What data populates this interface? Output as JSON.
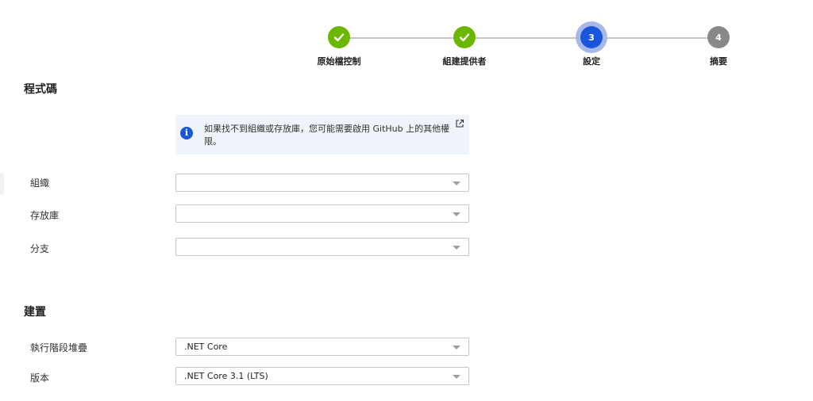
{
  "stepper": {
    "steps": [
      {
        "label": "原始檔控制",
        "number": "1",
        "state": "done"
      },
      {
        "label": "組建提供者",
        "number": "2",
        "state": "done"
      },
      {
        "label": "設定",
        "number": "3",
        "state": "current"
      },
      {
        "label": "摘要",
        "number": "4",
        "state": "todo"
      }
    ]
  },
  "code_section": {
    "title": "程式碼",
    "info_message": "如果找不到組織或存放庫，您可能需要啟用 GitHub 上的其他權限。",
    "organization_label": "組織",
    "organization_value": "",
    "repository_label": "存放庫",
    "repository_value": "",
    "branch_label": "分支",
    "branch_value": ""
  },
  "build_section": {
    "title": "建置",
    "runtime_stack_label": "執行階段堆疊",
    "runtime_stack_value": ".NET Core",
    "version_label": "版本",
    "version_value": ".NET Core 3.1 (LTS)"
  },
  "colors": {
    "done": "#6bb700",
    "current": "#1a56db",
    "todo": "#8a8886",
    "info_bg": "#eff4fb"
  }
}
